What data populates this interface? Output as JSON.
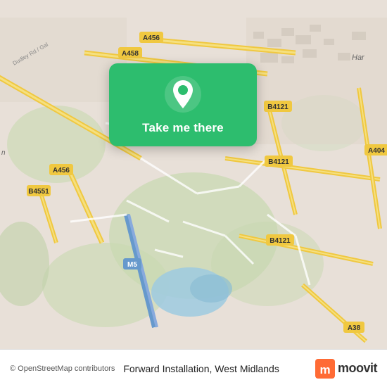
{
  "map": {
    "alt": "Map of West Midlands area showing road network"
  },
  "card": {
    "button_label": "Take me there",
    "pin_icon": "location-pin-icon"
  },
  "bottom_bar": {
    "copyright": "© OpenStreetMap contributors",
    "location_name": "Forward Installation, West Midlands",
    "moovit_label": "moovit"
  },
  "roads": {
    "a456": "A456",
    "a458": "A458",
    "b4121": "B4121",
    "a456_left": "A456",
    "b4551": "B4551",
    "m5": "M5",
    "a404": "A404",
    "a38": "A38"
  },
  "colors": {
    "map_bg": "#e8e0d8",
    "green_area": "#c8d8b0",
    "road_yellow": "#f5d67a",
    "road_white": "#ffffff",
    "road_label": "#a08030",
    "water": "#9ecae1",
    "card_green": "#2dbd6e",
    "moovit_orange": "#ff6b35"
  }
}
